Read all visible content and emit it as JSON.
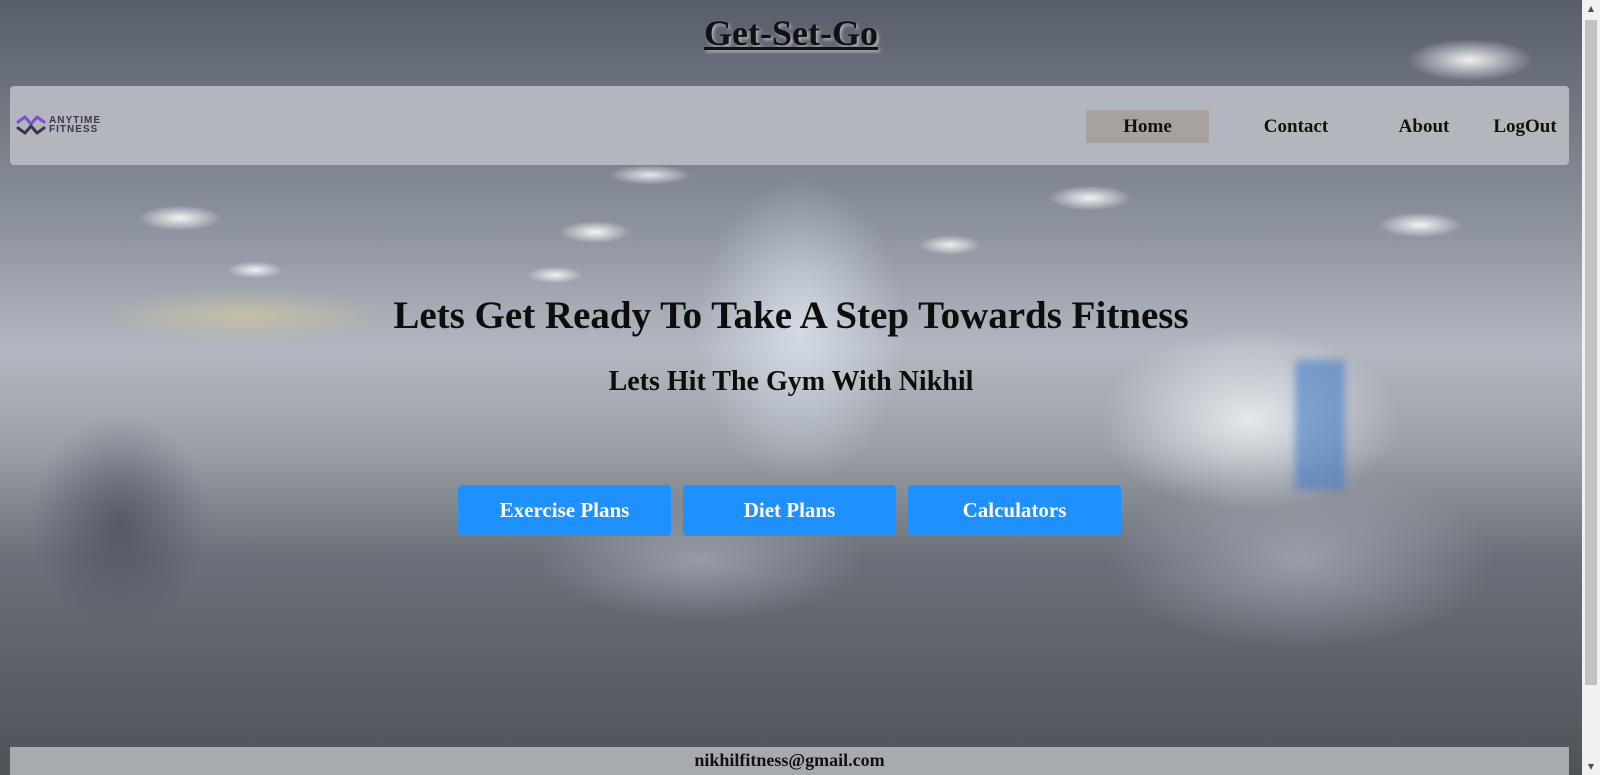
{
  "site": {
    "title": "Get-Set-Go"
  },
  "navbar": {
    "logo": {
      "line1": "ANYTIME",
      "line2": "FITNESS",
      "icon": "anytime-fitness-logo-icon",
      "accent": "#7b52c9"
    },
    "links": [
      {
        "label": "Home",
        "active": true
      },
      {
        "label": "Contact",
        "active": false
      },
      {
        "label": "About",
        "active": false
      },
      {
        "label": "LogOut",
        "active": false
      }
    ]
  },
  "hero": {
    "heading": "Lets Get Ready To Take A Step Towards Fitness",
    "subheading": "Lets Hit The Gym With Nikhil",
    "buttons": [
      {
        "label": "Exercise Plans"
      },
      {
        "label": "Diet Plans"
      },
      {
        "label": "Calculators"
      }
    ],
    "button_color": "#1e90ff"
  },
  "footer": {
    "email": "nikhilfitness@gmail.com"
  }
}
